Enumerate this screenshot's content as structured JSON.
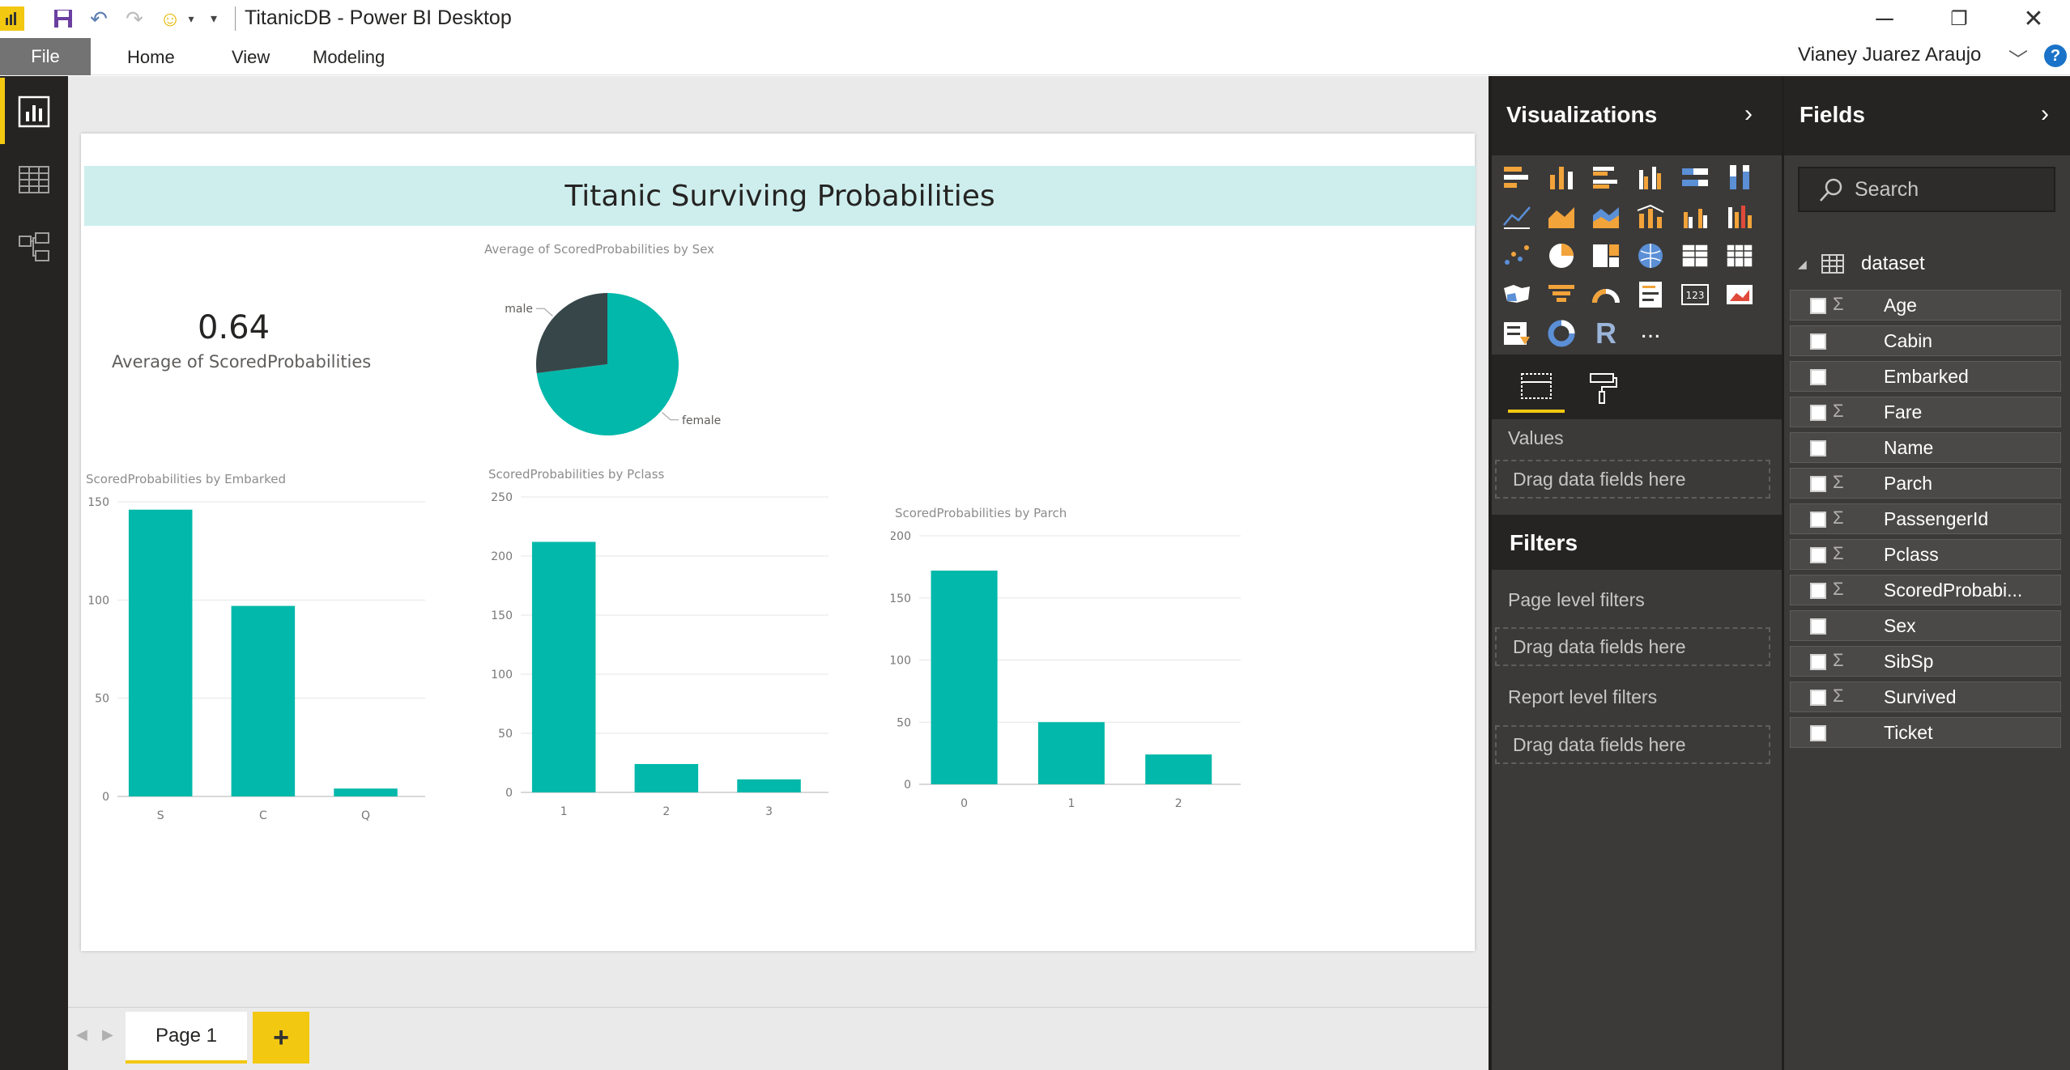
{
  "window": {
    "title": "TitanicDB - Power BI Desktop",
    "user": "Vianey Juarez Araujo",
    "help": "?"
  },
  "ribbon": {
    "file": "File",
    "tabs": [
      "Home",
      "View",
      "Modeling"
    ]
  },
  "report": {
    "title": "Titanic Surviving Probabilities",
    "card": {
      "value": "0.64",
      "label": "Average of ScoredProbabilities"
    },
    "pie_title": "Average of ScoredProbabilities by Sex",
    "embarked_title": "ScoredProbabilities by Embarked",
    "pclass_title": "ScoredProbabilities by Pclass",
    "parch_title": "ScoredProbabilities by Parch"
  },
  "chart_data": [
    {
      "type": "pie",
      "title": "Average of ScoredProbabilities by Sex",
      "categories": [
        "female",
        "male"
      ],
      "values": [
        0.73,
        0.27
      ],
      "colors": [
        "#01b8aa",
        "#374649"
      ]
    },
    {
      "type": "bar",
      "title": "ScoredProbabilities by Embarked",
      "categories": [
        "S",
        "C",
        "Q"
      ],
      "values": [
        146,
        97,
        4
      ],
      "ylim": [
        0,
        150
      ],
      "yticks": [
        0,
        50,
        100,
        150
      ],
      "color": "#01b8aa"
    },
    {
      "type": "bar",
      "title": "ScoredProbabilities by Pclass",
      "categories": [
        "1",
        "2",
        "3"
      ],
      "values": [
        212,
        24,
        11
      ],
      "ylim": [
        0,
        250
      ],
      "yticks": [
        0,
        50,
        100,
        150,
        200,
        250
      ],
      "color": "#01b8aa"
    },
    {
      "type": "bar",
      "title": "ScoredProbabilities by Parch",
      "categories": [
        "0",
        "1",
        "2"
      ],
      "values": [
        172,
        50,
        24
      ],
      "ylim": [
        0,
        200
      ],
      "yticks": [
        0,
        50,
        100,
        150,
        200
      ],
      "color": "#01b8aa"
    }
  ],
  "page_tabs": {
    "page1": "Page 1",
    "add": "+"
  },
  "visualizations": {
    "title": "Visualizations",
    "values_label": "Values",
    "drag_values": "Drag data fields here",
    "more": "..."
  },
  "filters": {
    "title": "Filters",
    "page_level": "Page level filters",
    "drag_page": "Drag data fields here",
    "report_level": "Report level filters",
    "drag_report": "Drag data fields here"
  },
  "fields": {
    "title": "Fields",
    "search_placeholder": "Search",
    "table": "dataset",
    "items": [
      {
        "name": "Age",
        "sigma": "Σ"
      },
      {
        "name": "Cabin",
        "sigma": ""
      },
      {
        "name": "Embarked",
        "sigma": ""
      },
      {
        "name": "Fare",
        "sigma": "Σ"
      },
      {
        "name": "Name",
        "sigma": ""
      },
      {
        "name": "Parch",
        "sigma": "Σ"
      },
      {
        "name": "PassengerId",
        "sigma": "Σ"
      },
      {
        "name": "Pclass",
        "sigma": "Σ"
      },
      {
        "name": "ScoredProbabi...",
        "sigma": "Σ"
      },
      {
        "name": "Sex",
        "sigma": ""
      },
      {
        "name": "SibSp",
        "sigma": "Σ"
      },
      {
        "name": "Survived",
        "sigma": "Σ"
      },
      {
        "name": "Ticket",
        "sigma": ""
      }
    ]
  }
}
